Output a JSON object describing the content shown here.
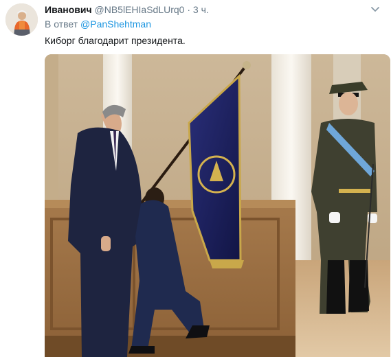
{
  "tweet": {
    "author_name": "Иванович",
    "handle": "@NB5lEHIaSdLUrq0",
    "separator": "·",
    "time": "3 ч.",
    "reply_prefix": "В ответ",
    "reply_to": "@PanShehtman",
    "text": "Киборг благодарит президента.",
    "media_icon": "photo",
    "caret_icon": "chevron-down-icon"
  }
}
